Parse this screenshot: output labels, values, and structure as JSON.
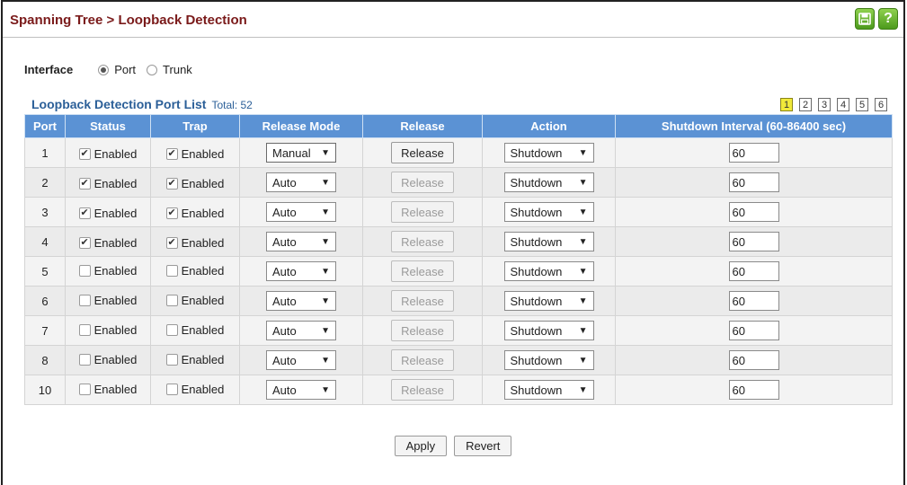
{
  "title": "Spanning Tree > Loopback Detection",
  "toolbar": {
    "save_icon": "save-icon",
    "help_label": "?"
  },
  "interface": {
    "label": "Interface",
    "options": [
      {
        "label": "Port",
        "selected": true
      },
      {
        "label": "Trunk",
        "selected": false
      }
    ]
  },
  "list": {
    "title": "Loopback Detection Port List",
    "total": "Total: 52"
  },
  "pages": [
    "1",
    "2",
    "3",
    "4",
    "5",
    "6"
  ],
  "current_page": "1",
  "columns": [
    "Port",
    "Status",
    "Trap",
    "Release Mode",
    "Release",
    "Action",
    "Shutdown Interval (60-86400 sec)"
  ],
  "rows": [
    {
      "port": "1",
      "status_checked": true,
      "status_label": "Enabled",
      "trap_checked": true,
      "trap_label": "Enabled",
      "release_mode": "Manual",
      "release": "Release",
      "release_enabled": true,
      "action": "Shutdown",
      "interval": "60"
    },
    {
      "port": "2",
      "status_checked": true,
      "status_label": "Enabled",
      "trap_checked": true,
      "trap_label": "Enabled",
      "release_mode": "Auto",
      "release": "Release",
      "release_enabled": false,
      "action": "Shutdown",
      "interval": "60"
    },
    {
      "port": "3",
      "status_checked": true,
      "status_label": "Enabled",
      "trap_checked": true,
      "trap_label": "Enabled",
      "release_mode": "Auto",
      "release": "Release",
      "release_enabled": false,
      "action": "Shutdown",
      "interval": "60"
    },
    {
      "port": "4",
      "status_checked": true,
      "status_label": "Enabled",
      "trap_checked": true,
      "trap_label": "Enabled",
      "release_mode": "Auto",
      "release": "Release",
      "release_enabled": false,
      "action": "Shutdown",
      "interval": "60"
    },
    {
      "port": "5",
      "status_checked": false,
      "status_label": "Enabled",
      "trap_checked": false,
      "trap_label": "Enabled",
      "release_mode": "Auto",
      "release": "Release",
      "release_enabled": false,
      "action": "Shutdown",
      "interval": "60"
    },
    {
      "port": "6",
      "status_checked": false,
      "status_label": "Enabled",
      "trap_checked": false,
      "trap_label": "Enabled",
      "release_mode": "Auto",
      "release": "Release",
      "release_enabled": false,
      "action": "Shutdown",
      "interval": "60"
    },
    {
      "port": "7",
      "status_checked": false,
      "status_label": "Enabled",
      "trap_checked": false,
      "trap_label": "Enabled",
      "release_mode": "Auto",
      "release": "Release",
      "release_enabled": false,
      "action": "Shutdown",
      "interval": "60"
    },
    {
      "port": "8",
      "status_checked": false,
      "status_label": "Enabled",
      "trap_checked": false,
      "trap_label": "Enabled",
      "release_mode": "Auto",
      "release": "Release",
      "release_enabled": false,
      "action": "Shutdown",
      "interval": "60"
    },
    {
      "port": "10",
      "status_checked": false,
      "status_label": "Enabled",
      "trap_checked": false,
      "trap_label": "Enabled",
      "release_mode": "Auto",
      "release": "Release",
      "release_enabled": false,
      "action": "Shutdown",
      "interval": "60"
    }
  ],
  "buttons": {
    "apply": "Apply",
    "revert": "Revert"
  },
  "colors": {
    "title": "#7a1a1a",
    "accent": "#2b5f98",
    "header_bg": "#5b92d4",
    "current_page": "#f0e93a",
    "icon_green": "#5aa827"
  }
}
